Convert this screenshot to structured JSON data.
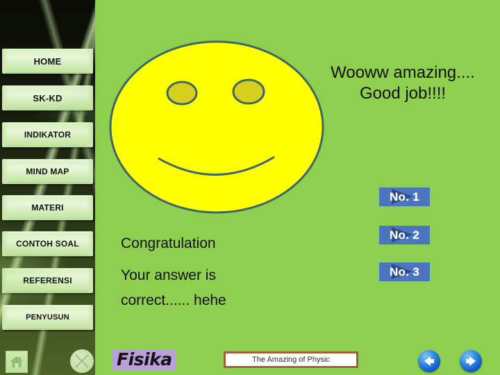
{
  "theme": {
    "background_green": "#8ecf4f",
    "sidebar_dark": "#10140a",
    "button_face": "#d9f0c2",
    "accent_blue": "#4a76bf",
    "accent_blue_dark": "#2c4a85",
    "smiley_yellow": "#ffff00",
    "smiley_outline": "#3d6669",
    "smiley_eye": "#d6cf1c",
    "logo_purple": "#b9a0db",
    "caption_border": "#a0603a"
  },
  "sidebar": {
    "items": [
      {
        "label": "HOME",
        "name": "home"
      },
      {
        "label": "SK-KD",
        "name": "sk-kd"
      },
      {
        "label": "INDIKATOR",
        "name": "indikator"
      },
      {
        "label": "MIND MAP",
        "name": "mind-map"
      },
      {
        "label": "MATERI",
        "name": "materi"
      },
      {
        "label": "CONTOH SOAL",
        "name": "contoh-soal"
      },
      {
        "label": "REFERENSI",
        "name": "referensi"
      },
      {
        "label": "PENYUSUN",
        "name": "penyusun"
      }
    ],
    "home_icon": "home-icon",
    "close_icon": "close-circle-icon"
  },
  "main": {
    "headline_line1": "Wooww amazing....",
    "headline_line2": "Good job!!!!",
    "message_line1": "Congratulation",
    "message_line2": "Your answer is",
    "message_line3": "correct...... hehe",
    "smiley_icon": "smiley-face-icon"
  },
  "question_buttons": [
    {
      "label": "No. 1"
    },
    {
      "label": "No. 2"
    },
    {
      "label": "No. 3"
    }
  ],
  "footer": {
    "logo_text": "Fisika",
    "caption": "The Amazing of Physic",
    "prev_icon": "arrow-left-icon",
    "next_icon": "arrow-right-icon"
  }
}
